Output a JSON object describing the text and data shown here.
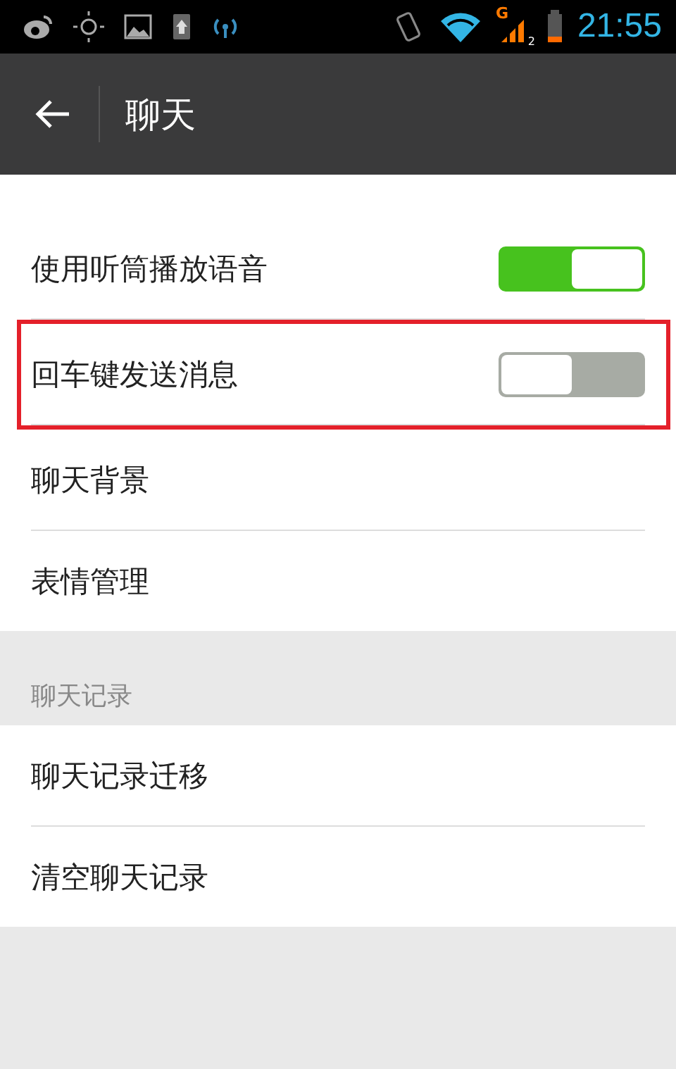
{
  "status_bar": {
    "network": "G",
    "sim": "2",
    "time": "21:55"
  },
  "header": {
    "title": "聊天"
  },
  "sections": [
    {
      "items": [
        {
          "kind": "toggle",
          "label": "使用听筒播放语音",
          "on": true,
          "highlighted": false
        },
        {
          "kind": "toggle",
          "label": "回车键发送消息",
          "on": false,
          "highlighted": true
        },
        {
          "kind": "link",
          "label": "聊天背景",
          "highlighted": false
        },
        {
          "kind": "link",
          "label": "表情管理",
          "highlighted": false
        }
      ]
    },
    {
      "title": "聊天记录",
      "items": [
        {
          "kind": "link",
          "label": "聊天记录迁移",
          "highlighted": false
        },
        {
          "kind": "link",
          "label": "清空聊天记录",
          "highlighted": false
        }
      ]
    }
  ]
}
